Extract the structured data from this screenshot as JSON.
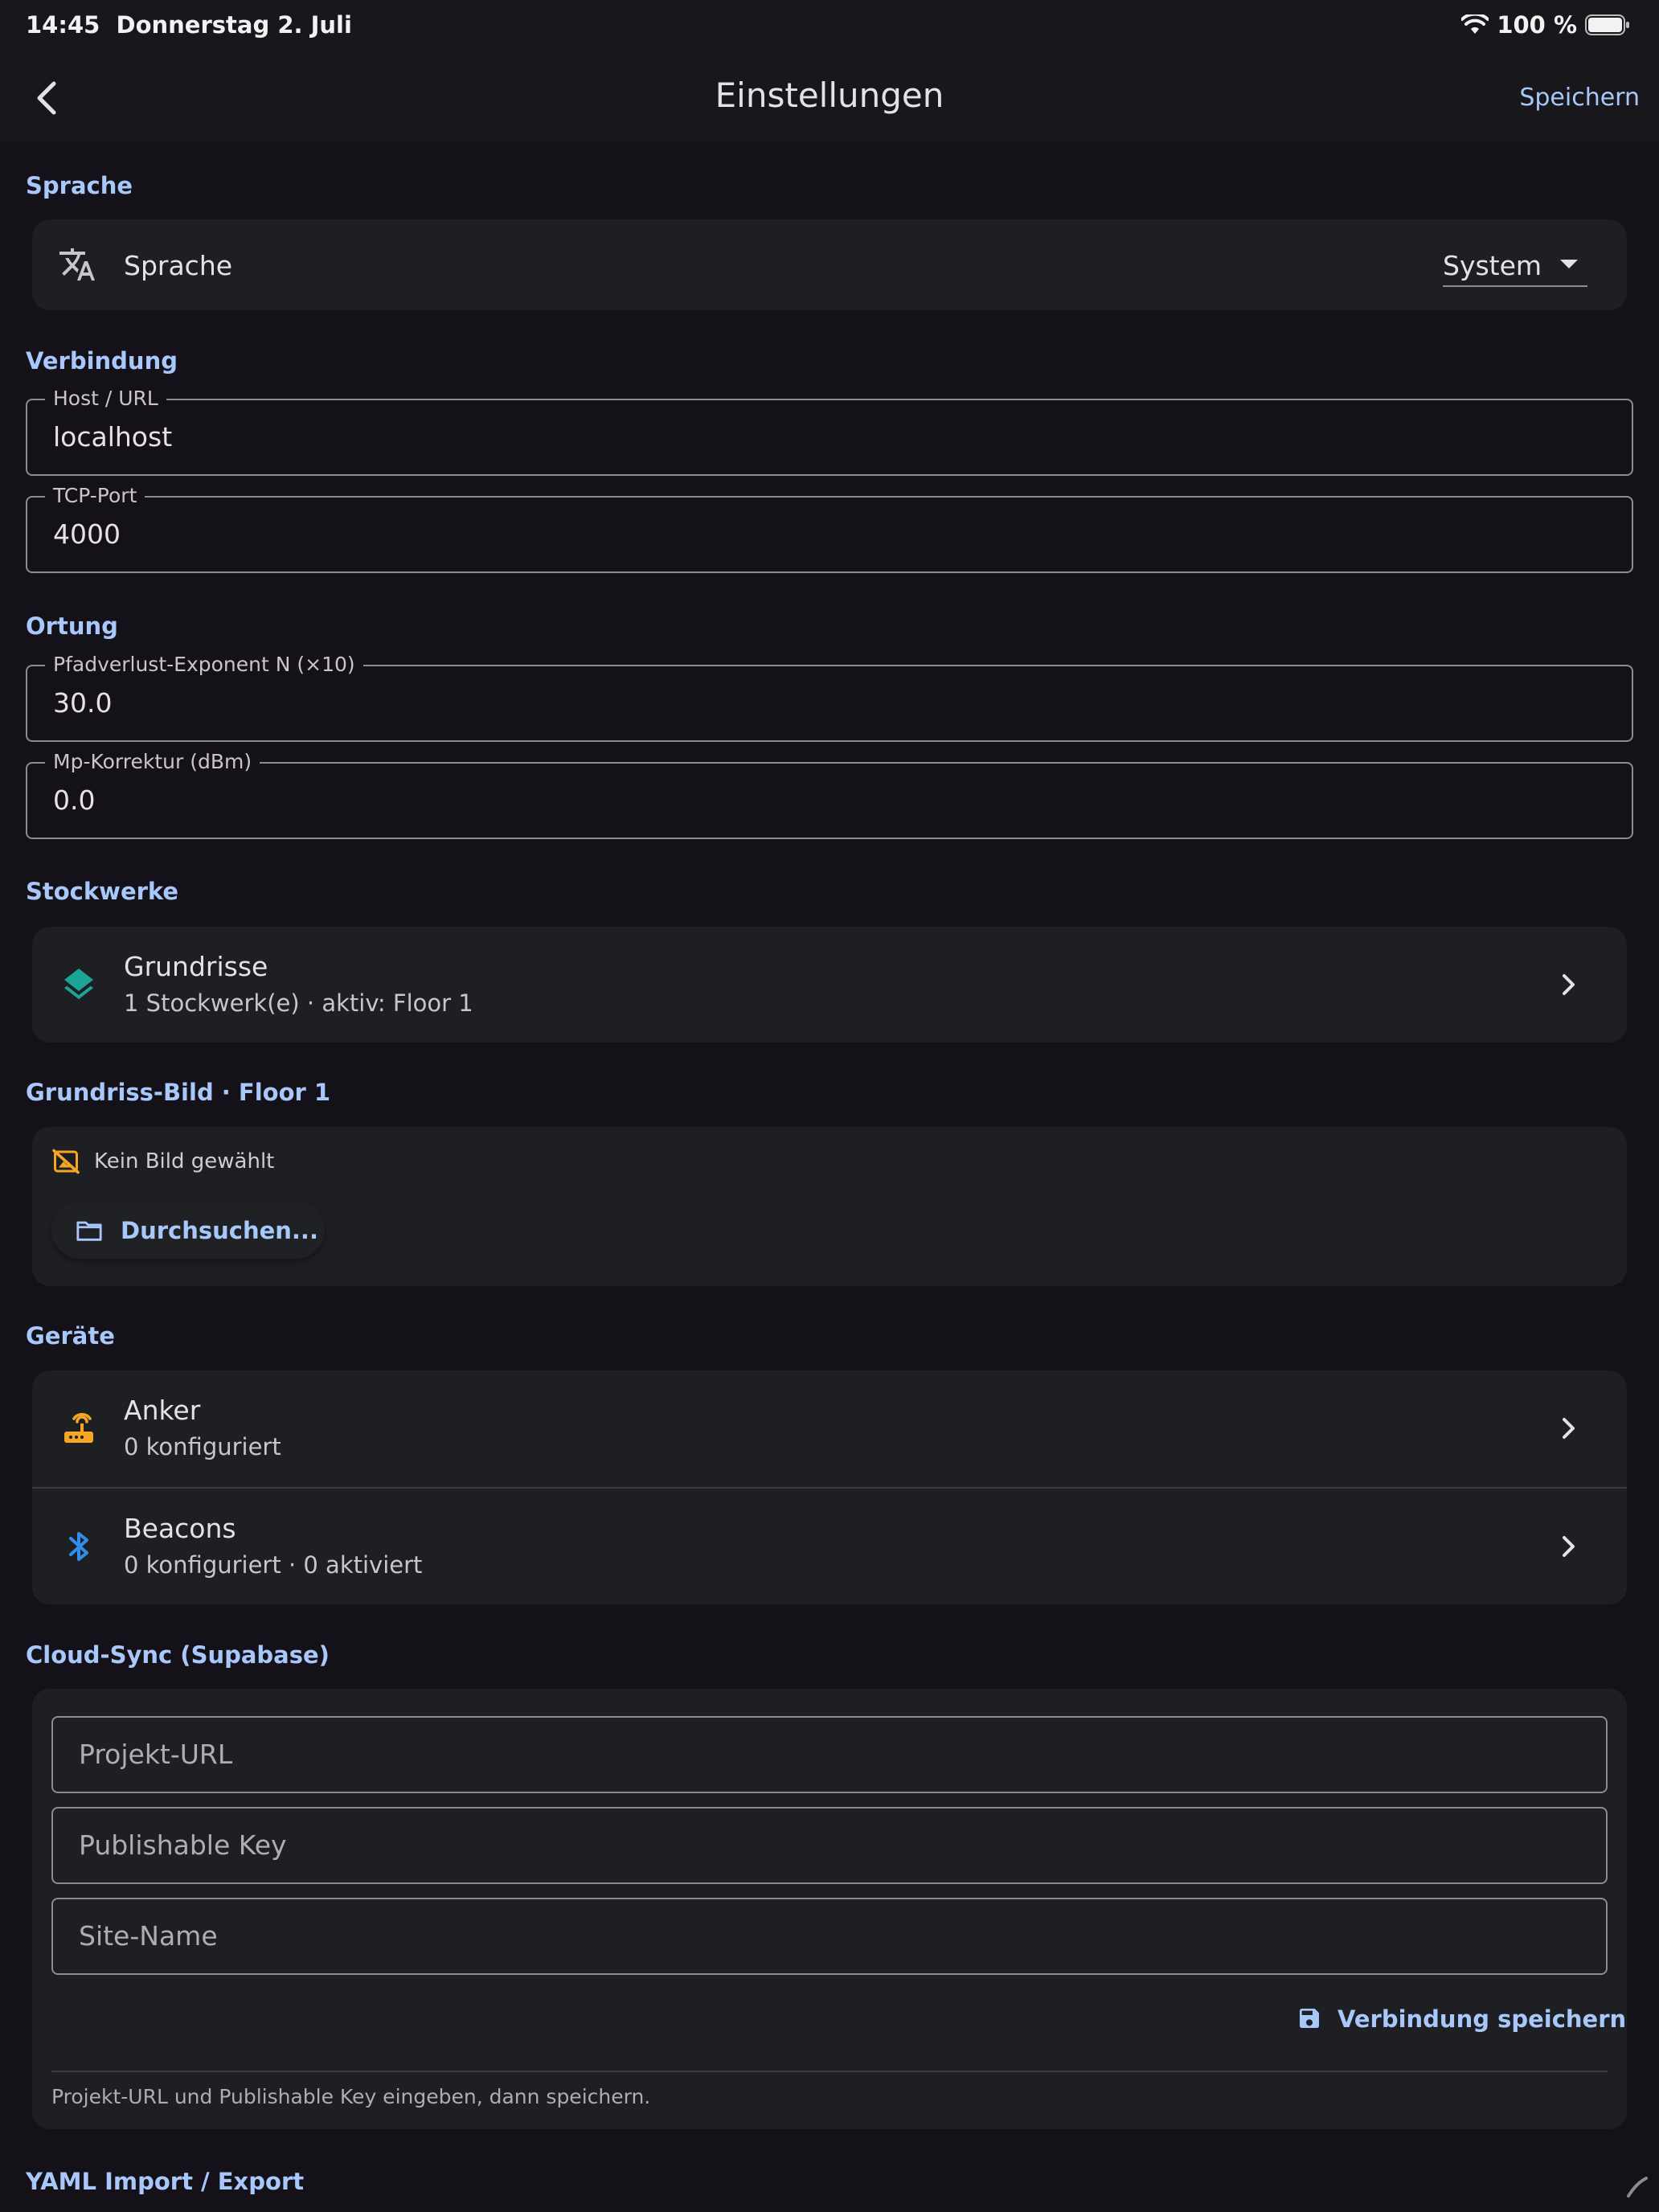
{
  "status": {
    "time": "14:45",
    "date": "Donnerstag 2. Juli",
    "battery": "100 %"
  },
  "appbar": {
    "title": "Einstellungen",
    "save": "Speichern"
  },
  "language": {
    "section": "Sprache",
    "label": "Sprache",
    "value": "System"
  },
  "connection": {
    "section": "Verbindung",
    "host_label": "Host / URL",
    "host_value": "localhost",
    "port_label": "TCP-Port",
    "port_value": "4000"
  },
  "location": {
    "section": "Ortung",
    "exponent_label": "Pfadverlust-Exponent N (×10)",
    "exponent_value": "30.0",
    "mp_label": "Mp-Korrektur (dBm)",
    "mp_value": "0.0"
  },
  "floors": {
    "section": "Stockwerke",
    "title": "Grundrisse",
    "subtitle": "1 Stockwerk(e) · aktiv: Floor 1"
  },
  "floorimage": {
    "section": "Grundriss-Bild · Floor 1",
    "empty": "Kein Bild gewählt",
    "browse": "Durchsuchen..."
  },
  "devices": {
    "section": "Geräte",
    "anchors_title": "Anker",
    "anchors_sub": "0 konfiguriert",
    "beacons_title": "Beacons",
    "beacons_sub": "0 konfiguriert · 0 aktiviert"
  },
  "cloud": {
    "section": "Cloud-Sync (Supabase)",
    "url_placeholder": "Projekt-URL",
    "key_placeholder": "Publishable Key",
    "site_placeholder": "Site-Name",
    "save": "Verbindung speichern",
    "hint": "Projekt-URL und Publishable Key eingeben, dann speichern."
  },
  "yaml": {
    "section": "YAML Import / Export"
  },
  "colors": {
    "accent": "#a8c7fa",
    "background": "#141218",
    "card": "#1d1f22",
    "teal": "#1ba497",
    "orange": "#f5a623",
    "blue": "#2f8fea"
  }
}
